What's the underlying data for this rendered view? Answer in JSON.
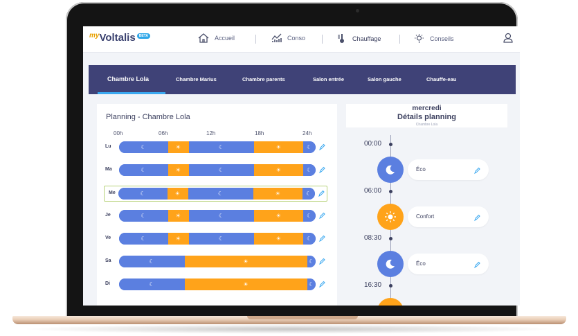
{
  "header": {
    "logo_my": "my",
    "logo_name": "Voltalis",
    "logo_badge": "BETA",
    "nav": [
      {
        "label": "Accueil",
        "icon": "home-icon"
      },
      {
        "label": "Conso",
        "icon": "chart-icon"
      },
      {
        "label": "Chauffage",
        "icon": "thermometer-icon"
      },
      {
        "label": "Conseils",
        "icon": "lightbulb-icon"
      }
    ],
    "active_nav": "Chauffage",
    "user_icon": "user-icon"
  },
  "rooms": {
    "tabs": [
      "Chambre Lola",
      "Chambre Marius",
      "Chambre parents",
      "Salon entrée",
      "Salon gauche",
      "Chauffe-eau"
    ],
    "active": "Chambre Lola"
  },
  "planning": {
    "title": "Planning - Chambre Lola",
    "hours": [
      "00h",
      "06h",
      "12h",
      "18h",
      "24h"
    ],
    "days": [
      {
        "label": "Lu",
        "segments": [
          [
            "eco",
            0,
            6
          ],
          [
            "confort",
            6,
            8.5
          ],
          [
            "eco",
            8.5,
            16.5
          ],
          [
            "confort",
            16.5,
            22.5
          ],
          [
            "eco",
            22.5,
            24
          ]
        ]
      },
      {
        "label": "Ma",
        "segments": [
          [
            "eco",
            0,
            6
          ],
          [
            "confort",
            6,
            8.5
          ],
          [
            "eco",
            8.5,
            16.5
          ],
          [
            "confort",
            16.5,
            22.5
          ],
          [
            "eco",
            22.5,
            24
          ]
        ]
      },
      {
        "label": "Me",
        "segments": [
          [
            "eco",
            0,
            6
          ],
          [
            "confort",
            6,
            8.5
          ],
          [
            "eco",
            8.5,
            16.5
          ],
          [
            "confort",
            16.5,
            22.5
          ],
          [
            "eco",
            22.5,
            24
          ]
        ],
        "selected": true
      },
      {
        "label": "Je",
        "segments": [
          [
            "eco",
            0,
            6
          ],
          [
            "confort",
            6,
            8.5
          ],
          [
            "eco",
            8.5,
            16.5
          ],
          [
            "confort",
            16.5,
            22.5
          ],
          [
            "eco",
            22.5,
            24
          ]
        ]
      },
      {
        "label": "Ve",
        "segments": [
          [
            "eco",
            0,
            6
          ],
          [
            "confort",
            6,
            8.5
          ],
          [
            "eco",
            8.5,
            16.5
          ],
          [
            "confort",
            16.5,
            22.5
          ],
          [
            "eco",
            22.5,
            24
          ]
        ]
      },
      {
        "label": "Sa",
        "segments": [
          [
            "eco",
            0,
            8
          ],
          [
            "confort",
            8,
            23
          ],
          [
            "eco",
            23,
            24
          ]
        ]
      },
      {
        "label": "Di",
        "segments": [
          [
            "eco",
            0,
            8
          ],
          [
            "confort",
            8,
            23
          ],
          [
            "eco",
            23,
            24
          ]
        ]
      }
    ]
  },
  "details": {
    "day": "mercredi",
    "title": "Détails planning",
    "subtitle": "Chambre Lola",
    "entries": [
      {
        "time": "00:00",
        "mode": "eco",
        "label": "Éco"
      },
      {
        "time": "06:00",
        "mode": "confort",
        "label": "Confort"
      },
      {
        "time": "08:30",
        "mode": "eco",
        "label": "Éco"
      },
      {
        "time": "16:30",
        "mode": "confort",
        "label": ""
      }
    ]
  },
  "colors": {
    "eco": "#5b7fe0",
    "confort": "#ffa31a",
    "tabs_bg": "#3f4277",
    "accent": "#3aa8f0"
  }
}
